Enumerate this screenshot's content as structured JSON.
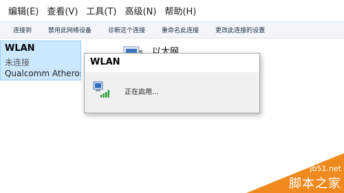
{
  "menu": [
    "编辑(E)",
    "查看(V)",
    "工具(T)",
    "高级(N)",
    "帮助(H)"
  ],
  "commands": [
    "连接到",
    "禁用此网络设备",
    "诊断这个连接",
    "重命名此连接",
    "更改此连接的设置"
  ],
  "adapters": {
    "wlan": {
      "name": "WLAN",
      "status": "未连接",
      "device": "Qualcomm Atheros"
    },
    "ethernet": {
      "name": "以太网"
    }
  },
  "dialog": {
    "title": "WLAN",
    "message": "正在启用..."
  },
  "watermark": {
    "url": "jb51.net",
    "text": "脚本之家"
  },
  "colors": {
    "selection": "#cce8ff",
    "selection_border": "#99d1ff",
    "watermark_orange": "#f08a1e"
  },
  "icons": {
    "adapter": "network-adapter-icon",
    "wifi": "wifi-signal-icon"
  }
}
